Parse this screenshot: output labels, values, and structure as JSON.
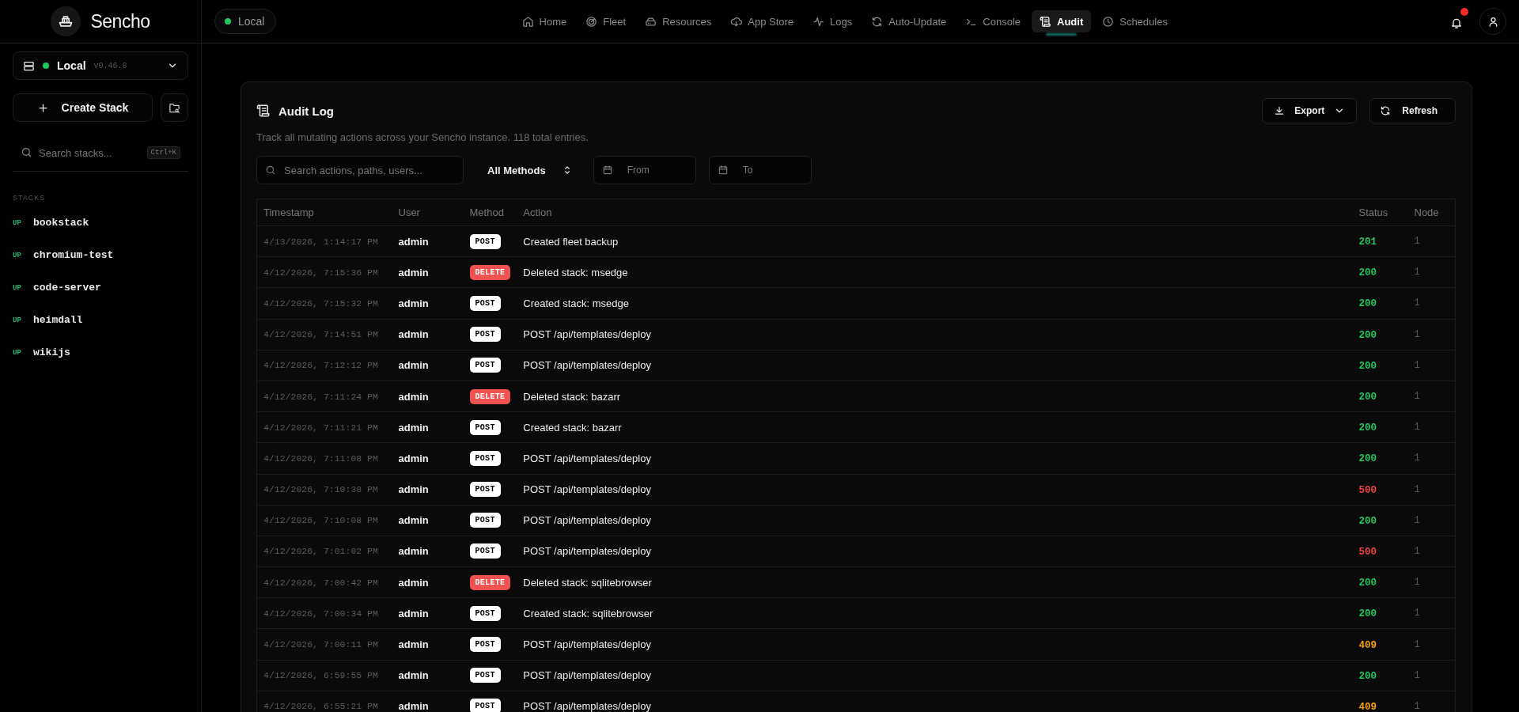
{
  "topbar": {
    "brand": "Sencho",
    "environment": {
      "label": "Local",
      "online": true
    },
    "nav": [
      {
        "label": "Home",
        "selected": false
      },
      {
        "label": "Fleet",
        "selected": false
      },
      {
        "label": "Resources",
        "selected": false
      },
      {
        "label": "App Store",
        "selected": false
      },
      {
        "label": "Logs",
        "selected": false
      },
      {
        "label": "Auto-Update",
        "selected": false
      },
      {
        "label": "Console",
        "selected": false
      },
      {
        "label": "Audit",
        "selected": true
      },
      {
        "label": "Schedules",
        "selected": false
      }
    ],
    "notifications_unread": true
  },
  "sidebar": {
    "environment": {
      "name": "Local",
      "version": "v0.46.8",
      "online": true
    },
    "create_button": "Create Stack",
    "search": {
      "placeholder": "Search stacks...",
      "shortcut": "Ctrl+K"
    },
    "section_label": "STACKS",
    "stacks": [
      {
        "status": "UP",
        "name": "bookstack"
      },
      {
        "status": "UP",
        "name": "chromium-test"
      },
      {
        "status": "UP",
        "name": "code-server"
      },
      {
        "status": "UP",
        "name": "heimdall"
      },
      {
        "status": "UP",
        "name": "wikijs"
      }
    ]
  },
  "audit": {
    "title": "Audit Log",
    "description": "Track all mutating actions across your Sencho instance. 118 total entries.",
    "export_button": "Export",
    "refresh_button": "Refresh",
    "filters": {
      "search_placeholder": "Search actions, paths, users...",
      "method_select": "All Methods",
      "from_placeholder": "From",
      "to_placeholder": "To"
    },
    "table": {
      "columns": [
        "Timestamp",
        "User",
        "Method",
        "Action",
        "Status",
        "Node"
      ],
      "rows": [
        {
          "timestamp": "4/13/2026, 1:14:17 PM",
          "user": "admin",
          "method": {
            "label": "POST",
            "color": "#ffffff"
          },
          "action": "Created fleet backup",
          "status": {
            "label": "201",
            "color": "#22c55e"
          },
          "node": "1"
        },
        {
          "timestamp": "4/12/2026, 7:15:36 PM",
          "user": "admin",
          "method": {
            "label": "DELETE",
            "color": "#f05252"
          },
          "action": "Deleted stack: msedge",
          "status": {
            "label": "200",
            "color": "#22c55e"
          },
          "node": "1"
        },
        {
          "timestamp": "4/12/2026, 7:15:32 PM",
          "user": "admin",
          "method": {
            "label": "POST",
            "color": "#ffffff"
          },
          "action": "Created stack: msedge",
          "status": {
            "label": "200",
            "color": "#22c55e"
          },
          "node": "1"
        },
        {
          "timestamp": "4/12/2026, 7:14:51 PM",
          "user": "admin",
          "method": {
            "label": "POST",
            "color": "#ffffff"
          },
          "action": "POST /api/templates/deploy",
          "status": {
            "label": "200",
            "color": "#22c55e"
          },
          "node": "1"
        },
        {
          "timestamp": "4/12/2026, 7:12:12 PM",
          "user": "admin",
          "method": {
            "label": "POST",
            "color": "#ffffff"
          },
          "action": "POST /api/templates/deploy",
          "status": {
            "label": "200",
            "color": "#22c55e"
          },
          "node": "1"
        },
        {
          "timestamp": "4/12/2026, 7:11:24 PM",
          "user": "admin",
          "method": {
            "label": "DELETE",
            "color": "#f05252"
          },
          "action": "Deleted stack: bazarr",
          "status": {
            "label": "200",
            "color": "#22c55e"
          },
          "node": "1"
        },
        {
          "timestamp": "4/12/2026, 7:11:21 PM",
          "user": "admin",
          "method": {
            "label": "POST",
            "color": "#ffffff"
          },
          "action": "Created stack: bazarr",
          "status": {
            "label": "200",
            "color": "#22c55e"
          },
          "node": "1"
        },
        {
          "timestamp": "4/12/2026, 7:11:08 PM",
          "user": "admin",
          "method": {
            "label": "POST",
            "color": "#ffffff"
          },
          "action": "POST /api/templates/deploy",
          "status": {
            "label": "200",
            "color": "#22c55e"
          },
          "node": "1"
        },
        {
          "timestamp": "4/12/2026, 7:10:38 PM",
          "user": "admin",
          "method": {
            "label": "POST",
            "color": "#ffffff"
          },
          "action": "POST /api/templates/deploy",
          "status": {
            "label": "500",
            "color": "#ef4444"
          },
          "node": "1"
        },
        {
          "timestamp": "4/12/2026, 7:10:08 PM",
          "user": "admin",
          "method": {
            "label": "POST",
            "color": "#ffffff"
          },
          "action": "POST /api/templates/deploy",
          "status": {
            "label": "200",
            "color": "#22c55e"
          },
          "node": "1"
        },
        {
          "timestamp": "4/12/2026, 7:01:02 PM",
          "user": "admin",
          "method": {
            "label": "POST",
            "color": "#ffffff"
          },
          "action": "POST /api/templates/deploy",
          "status": {
            "label": "500",
            "color": "#ef4444"
          },
          "node": "1"
        },
        {
          "timestamp": "4/12/2026, 7:00:42 PM",
          "user": "admin",
          "method": {
            "label": "DELETE",
            "color": "#f05252"
          },
          "action": "Deleted stack: sqlitebrowser",
          "status": {
            "label": "200",
            "color": "#22c55e"
          },
          "node": "1"
        },
        {
          "timestamp": "4/12/2026, 7:00:34 PM",
          "user": "admin",
          "method": {
            "label": "POST",
            "color": "#ffffff"
          },
          "action": "Created stack: sqlitebrowser",
          "status": {
            "label": "200",
            "color": "#22c55e"
          },
          "node": "1"
        },
        {
          "timestamp": "4/12/2026, 7:00:11 PM",
          "user": "admin",
          "method": {
            "label": "POST",
            "color": "#ffffff"
          },
          "action": "POST /api/templates/deploy",
          "status": {
            "label": "409",
            "color": "#f59e0b"
          },
          "node": "1"
        },
        {
          "timestamp": "4/12/2026, 6:59:55 PM",
          "user": "admin",
          "method": {
            "label": "POST",
            "color": "#ffffff"
          },
          "action": "POST /api/templates/deploy",
          "status": {
            "label": "200",
            "color": "#22c55e"
          },
          "node": "1"
        },
        {
          "timestamp": "4/12/2026, 6:55:21 PM",
          "user": "admin",
          "method": {
            "label": "POST",
            "color": "#ffffff"
          },
          "action": "POST /api/templates/deploy",
          "status": {
            "label": "409",
            "color": "#f59e0b"
          },
          "node": "1"
        }
      ]
    }
  }
}
